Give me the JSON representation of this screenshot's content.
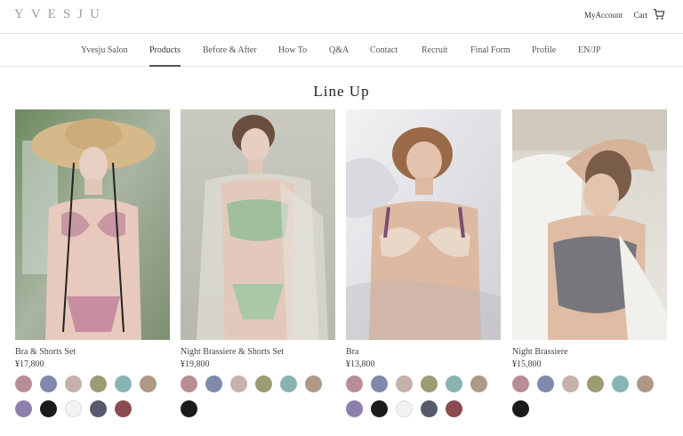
{
  "header": {
    "logo": "YVESJU",
    "account_label": "MyAccount",
    "cart_label": "Cart",
    "cart_icon": "cart-icon"
  },
  "nav": {
    "items": [
      "Yvesju Salon",
      "Products",
      "Before & After",
      "How To",
      "Q&A",
      "Contact",
      "Recruit",
      "Final Form",
      "Profile",
      "EN/JP"
    ],
    "active": "Products"
  },
  "page": {
    "title": "Line Up"
  },
  "products": [
    {
      "name": "Bra & Shorts Set",
      "price": "¥17,800",
      "swatches": [
        "#b98d96",
        "#7f89ad",
        "#c7b1ab",
        "#9c9c74",
        "#87b4b3",
        "#ae9886",
        "#8e80ad",
        "#1b1b1b",
        "#f2f2f2",
        "#565a6c",
        "#8a4c50"
      ]
    },
    {
      "name": "Night Brassiere & Shorts Set",
      "price": "¥19,800",
      "swatches": [
        "#b98d96",
        "#7f89ad",
        "#c7b1ab",
        "#9c9c74",
        "#87b4b3",
        "#ae9886",
        "#1b1b1b"
      ]
    },
    {
      "name": "Bra",
      "price": "¥13,800",
      "swatches": [
        "#b98d96",
        "#7f89ad",
        "#c7b1ab",
        "#9c9c74",
        "#87b4b3",
        "#ae9886",
        "#8e80ad",
        "#1b1b1b",
        "#f2f2f2",
        "#565a6c",
        "#8a4c50"
      ]
    },
    {
      "name": "Night Brassiere",
      "price": "¥15,800",
      "swatches": [
        "#b98d96",
        "#7f89ad",
        "#c7b1ab",
        "#9c9c74",
        "#87b4b3",
        "#ae9886",
        "#1b1b1b"
      ]
    }
  ]
}
